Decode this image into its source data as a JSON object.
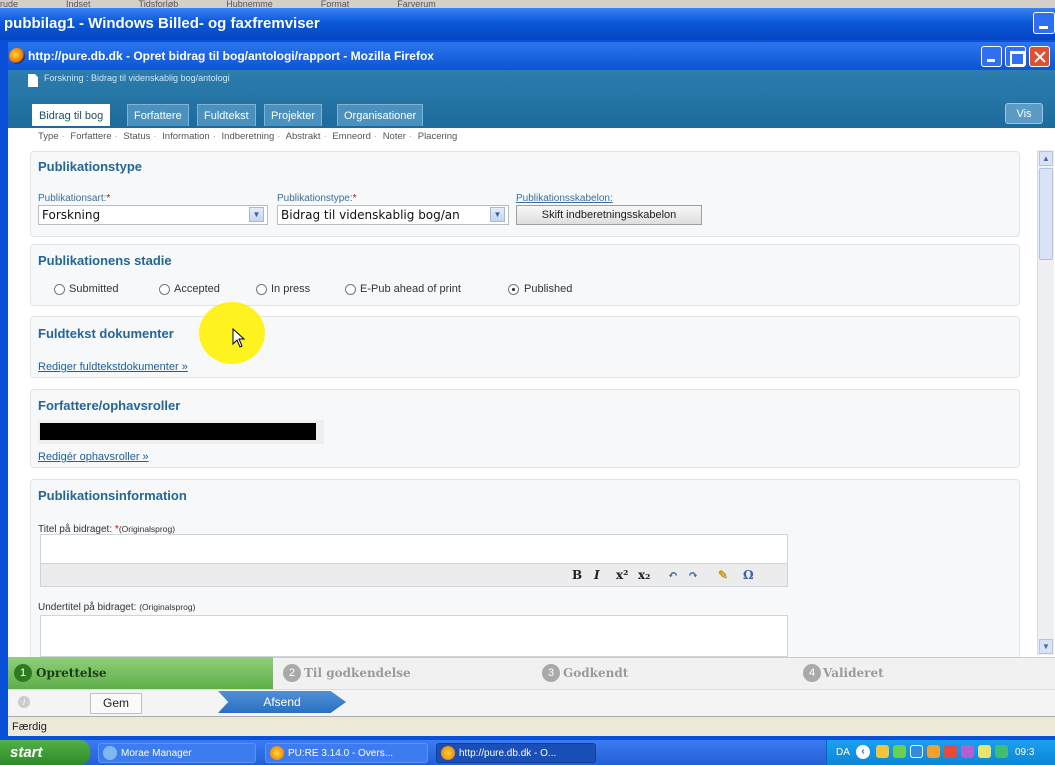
{
  "outer_window": {
    "title": "pubbilag1 - Windows Billed- og faxfremviser",
    "strip": [
      "rude",
      "Indset",
      "Tidsforløb",
      "Hubnemme",
      "Format",
      "Farverum"
    ]
  },
  "browser": {
    "title": "http://pure.db.dk - Opret bidrag til bog/antologi/rapport - Mozilla Firefox",
    "status": "Færdig"
  },
  "header": {
    "breadcrumb": "Forskning : Bidrag til videnskablig bog/antologi",
    "tabs": [
      "Bidrag til bog",
      "Forfattere",
      "Fuldtekst",
      "Projekter",
      "Organisationer"
    ],
    "vis_label": "Vis"
  },
  "subnav": [
    "Type",
    "Forfattere",
    "Status",
    "Information",
    "Indberetning",
    "Abstrakt",
    "Emneord",
    "Noter",
    "Placering"
  ],
  "pubtype": {
    "heading": "Publikationstype",
    "art_label": "Publikationsart:",
    "art_value": "Forskning",
    "type_label": "Publikationstype:",
    "type_value": "Bidrag til videnskablig bog/an",
    "template_label": "Publikationsskabelon:",
    "template_button": "Skift indberetningsskabelon",
    "req": "*"
  },
  "stage": {
    "heading": "Publikationens stadie",
    "options": [
      "Submitted",
      "Accepted",
      "In press",
      "E-Pub ahead of print",
      "Published"
    ],
    "selected": "Published"
  },
  "fulltext": {
    "heading": "Fuldtekst dokumenter",
    "link": "Rediger fuldtekstdokumenter »"
  },
  "authors": {
    "heading": "Forfattere/ophavsroller",
    "link": "Redigér ophavsroller »"
  },
  "pubinfo": {
    "heading": "Publikationsinformation",
    "title_label": "Titel på bidraget:",
    "title_hint": "(Originalsprog)",
    "req": "*",
    "subtitle_label": "Undertitel på bidraget:",
    "subtitle_hint": "(Originalsprog)",
    "toolbar": [
      "B",
      "I",
      "x²",
      "x₂",
      "↶",
      "↷",
      "✎",
      "Ω"
    ]
  },
  "workflow": {
    "steps": [
      "Oprettelse",
      "Til godkendelse",
      "Godkendt",
      "Valideret"
    ],
    "numbers": [
      "1",
      "2",
      "3",
      "4"
    ],
    "active_step": "Oprettelse"
  },
  "actions": {
    "save": "Gem",
    "send": "Afsend"
  },
  "taskbar": {
    "start": "start",
    "items": [
      "Morae Manager",
      "PU:RE 3.14.0 - Overs...",
      "http://pure.db.dk - O..."
    ],
    "lang": "DA",
    "clock": "09:3"
  }
}
